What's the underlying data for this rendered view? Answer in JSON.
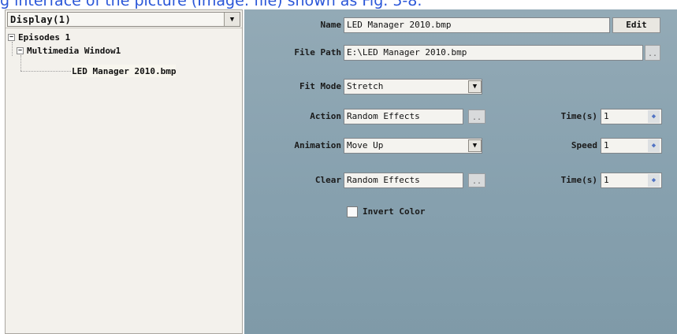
{
  "caption": "g interface of the picture (Image: file) shown as Fig. 5-8.",
  "left_panel": {
    "combo_value": "Display(1)",
    "tree": [
      {
        "label": "Episodes 1",
        "expander": "−"
      },
      {
        "label": "Multimedia Window1",
        "expander": "−"
      },
      {
        "label": "LED Manager 2010.bmp"
      }
    ]
  },
  "form": {
    "name_label": "Name",
    "name_value": "LED Manager 2010.bmp",
    "edit_label": "Edit",
    "file_path_label": "File Path",
    "file_path_value": "E:\\LED Manager 2010.bmp",
    "browse_label": "..",
    "fit_mode_label": "Fit Mode",
    "fit_mode_value": "Stretch",
    "action_label": "Action",
    "action_value": "Random Effects",
    "action_btn_label": "..",
    "action_time_label": "Time(s)",
    "action_time_value": "1",
    "animation_label": "Animation",
    "animation_value": "Move Up",
    "speed_label": "Speed",
    "speed_value": "1",
    "clear_label": "Clear",
    "clear_value": "Random Effects",
    "clear_btn_label": "..",
    "clear_time_label": "Time(s)",
    "clear_time_value": "1",
    "invert_label": "Invert Color",
    "invert_checked": false
  },
  "icons": {
    "dropdown": "▼",
    "spin": "◆"
  }
}
